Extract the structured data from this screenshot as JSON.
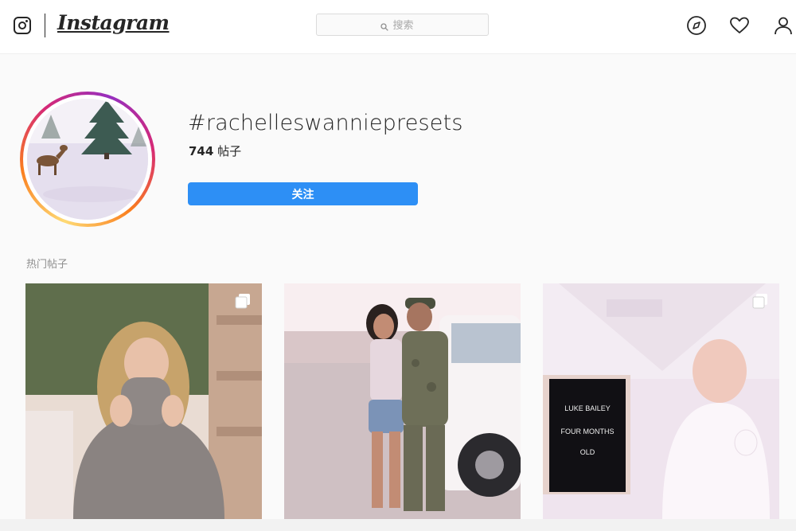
{
  "nav": {
    "brand": "Instagram",
    "search_placeholder": "搜索"
  },
  "header": {
    "hashtag": "#rachelleswanniepresets",
    "post_count": "744",
    "post_count_unit": " 帖子",
    "follow_label": "关注"
  },
  "sections": {
    "top_posts_label": "热门帖子"
  },
  "posts": [
    {
      "icon": "multiple-photos-icon"
    },
    {
      "icon": ""
    },
    {
      "icon": "multiple-photos-icon",
      "sign_lines": [
        "LUKE BAILEY",
        "FOUR MONTHS",
        "OLD"
      ]
    }
  ],
  "colors": {
    "follow_button": "#2d8ff5",
    "story_ring": [
      "#feda75",
      "#fa7e1e",
      "#d62976",
      "#962fbf"
    ]
  }
}
